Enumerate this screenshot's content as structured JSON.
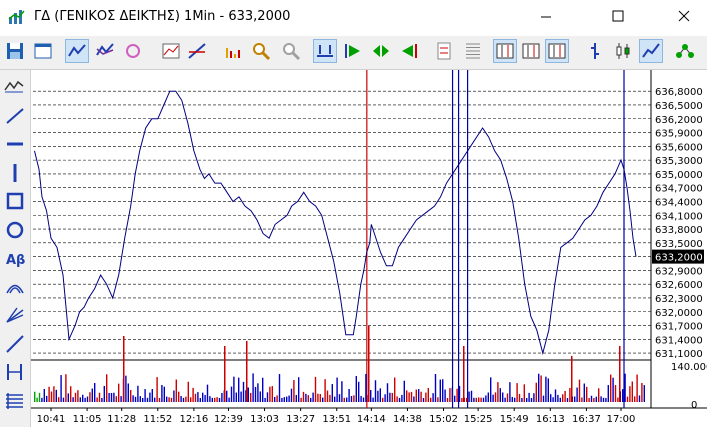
{
  "window": {
    "title": "ΓΔ (ΓΕΝΙΚΟΣ ΔΕΙΚΤΗΣ) 1Min - 633,2000",
    "controls": [
      "minimize-icon",
      "maximize-icon",
      "close-icon"
    ]
  },
  "toolbar": {
    "buttons": [
      {
        "name": "save-button",
        "icon": "floppy-disk-icon"
      },
      {
        "name": "properties-button",
        "icon": "window-icon"
      },
      {
        "name": "chart-style-button",
        "icon": "candlestick-icon",
        "pressed": true
      },
      {
        "name": "compare-button",
        "icon": "compare-icon"
      },
      {
        "name": "refresh-button",
        "icon": "refresh-icon"
      },
      {
        "name": "indicator-button",
        "icon": "indicator-icon"
      },
      {
        "name": "trendline-tool-button",
        "icon": "trendline-icon"
      },
      {
        "name": "volume-button",
        "icon": "volume-bars-icon"
      },
      {
        "name": "zoom-in-button",
        "icon": "zoom-in-icon"
      },
      {
        "name": "zoom-out-button",
        "icon": "zoom-out-icon"
      },
      {
        "name": "fit-button",
        "icon": "fit-icon",
        "pressed": true
      },
      {
        "name": "scroll-start-button",
        "icon": "go-start-icon"
      },
      {
        "name": "scroll-mid-button",
        "icon": "go-center-icon"
      },
      {
        "name": "scroll-end-button",
        "icon": "go-end-icon"
      },
      {
        "name": "decimals-button",
        "icon": "decimals-icon"
      },
      {
        "name": "grid-button",
        "icon": "grid-icon"
      },
      {
        "name": "interval-5-button",
        "icon": "interval-icon",
        "pressed": true
      },
      {
        "name": "interval-10-button",
        "icon": "interval-icon"
      },
      {
        "name": "interval-510-button",
        "icon": "interval-icon",
        "pressed": true
      },
      {
        "name": "bar-chart-button",
        "icon": "bar-icon"
      },
      {
        "name": "candle-chart-button",
        "icon": "candle-icon"
      },
      {
        "name": "line-chart-button",
        "icon": "line-icon",
        "pressed": true
      },
      {
        "name": "network-button",
        "icon": "network-icon"
      }
    ]
  },
  "drawing_tools": [
    {
      "name": "autoline-tool",
      "icon": "zigzag-icon"
    },
    {
      "name": "line-tool",
      "icon": "diagonal-line-icon"
    },
    {
      "name": "horizontal-line-tool",
      "icon": "horizontal-line-icon"
    },
    {
      "name": "vertical-line-tool",
      "icon": "vertical-line-icon"
    },
    {
      "name": "rectangle-tool",
      "icon": "rectangle-icon"
    },
    {
      "name": "ellipse-tool",
      "icon": "ellipse-icon"
    },
    {
      "name": "text-tool",
      "icon": "text-icon",
      "label": "Aβ"
    },
    {
      "name": "arc-tool",
      "icon": "arc-icon"
    },
    {
      "name": "fan-tool",
      "icon": "fan-icon"
    },
    {
      "name": "ray-tool",
      "icon": "ray-icon"
    },
    {
      "name": "channel-tool",
      "icon": "channel-icon"
    },
    {
      "name": "fibonacci-tool",
      "icon": "fibonacci-icon"
    }
  ],
  "colors": {
    "price_line": "#000080",
    "volume_blue": "#0000c0",
    "volume_red": "#cc0000",
    "volume_green": "#00a000",
    "grid": "#000000",
    "marker_red": "#cc0000",
    "marker_blue": "#0000aa",
    "current_price_bg": "#000000",
    "current_price_fg": "#ffffff"
  },
  "chart_data": {
    "type": "line",
    "title": "ΓΔ (ΓΕΝΙΚΟΣ ΔΕΙΚΤΗΣ) 1Min",
    "y_tick_labels": [
      "636,8000",
      "636,5000",
      "636,2000",
      "635,9000",
      "635,6000",
      "635,3000",
      "635,0000",
      "634,7000",
      "634,4000",
      "634,1000",
      "633,8000",
      "633,5000",
      "633,2000",
      "632,9000",
      "632,6000",
      "632,3000",
      "632,0000",
      "631,7000",
      "631,4000",
      "631,1000"
    ],
    "ylim": [
      630.95,
      637.0
    ],
    "current_price": 633.2,
    "current_price_label": "633,2000",
    "x_tick_labels": [
      "10:41",
      "11:05",
      "11:28",
      "11:52",
      "12:16",
      "12:39",
      "13:03",
      "13:27",
      "13:51",
      "14:14",
      "14:38",
      "15:02",
      "15:25",
      "15:49",
      "16:13",
      "16:37",
      "17:00"
    ],
    "series": [
      {
        "name": "",
        "x": [
          "10:30",
          "10:33",
          "10:35",
          "10:38",
          "10:41",
          "10:45",
          "10:49",
          "10:53",
          "10:57",
          "11:00",
          "11:03",
          "11:06",
          "11:10",
          "11:14",
          "11:18",
          "11:22",
          "11:26",
          "11:30",
          "11:34",
          "11:37",
          "11:40",
          "11:44",
          "11:48",
          "11:52",
          "11:56",
          "12:00",
          "12:04",
          "12:08",
          "12:12",
          "12:14",
          "12:16",
          "12:18",
          "12:20",
          "12:23",
          "12:26",
          "12:30",
          "12:34",
          "12:38",
          "12:42",
          "12:46",
          "12:50",
          "12:54",
          "12:58",
          "13:02",
          "13:06",
          "13:10",
          "13:14",
          "13:18",
          "13:21",
          "13:25",
          "13:29",
          "13:33",
          "13:37",
          "13:41",
          "13:45",
          "13:49",
          "13:53",
          "13:57",
          "14:00",
          "14:02",
          "14:04",
          "14:07",
          "14:09",
          "14:11",
          "14:13",
          "14:14",
          "14:16",
          "14:20",
          "14:24",
          "14:28",
          "14:32",
          "14:36",
          "14:40",
          "14:44",
          "14:48",
          "14:52",
          "14:56",
          "15:00",
          "15:04",
          "15:08",
          "15:12",
          "15:16",
          "15:20",
          "15:24",
          "15:28",
          "15:32",
          "15:36",
          "15:40",
          "15:44",
          "15:48",
          "15:52",
          "15:56",
          "16:00",
          "16:04",
          "16:08",
          "16:12",
          "16:16",
          "16:20",
          "16:24",
          "16:28",
          "16:32",
          "16:36",
          "16:40",
          "16:44",
          "16:48",
          "16:52",
          "16:56",
          "17:00",
          "17:02",
          "17:04",
          "17:06",
          "17:08",
          "17:10"
        ],
        "values": [
          635.5,
          635.1,
          634.5,
          634.2,
          633.6,
          633.4,
          632.8,
          631.4,
          631.7,
          632.0,
          632.1,
          632.3,
          632.5,
          632.8,
          632.6,
          632.3,
          632.8,
          633.6,
          634.3,
          635.0,
          635.5,
          636.0,
          636.2,
          636.2,
          636.5,
          636.8,
          636.8,
          636.6,
          636.1,
          635.8,
          635.5,
          635.3,
          635.1,
          634.9,
          635.0,
          634.8,
          634.8,
          634.6,
          634.4,
          634.5,
          634.3,
          634.2,
          634.0,
          633.7,
          633.6,
          633.9,
          634.0,
          634.1,
          634.3,
          634.4,
          634.6,
          634.4,
          634.3,
          634.1,
          633.6,
          633.1,
          632.4,
          631.5,
          631.5,
          631.5,
          631.9,
          632.6,
          632.9,
          633.3,
          633.5,
          633.9,
          633.7,
          633.3,
          633.0,
          633.0,
          633.4,
          633.6,
          633.8,
          634.0,
          634.1,
          634.2,
          634.3,
          634.5,
          634.8,
          635.0,
          635.2,
          635.4,
          635.6,
          635.8,
          636.0,
          635.8,
          635.5,
          635.3,
          634.9,
          634.4,
          633.6,
          632.6,
          631.9,
          631.6,
          631.1,
          631.6,
          632.6,
          633.4,
          633.5,
          633.6,
          633.8,
          634.0,
          634.1,
          634.3,
          634.6,
          634.8,
          635.0,
          635.3,
          635.1,
          634.7,
          634.2,
          633.6,
          633.2
        ]
      }
    ],
    "volume": {
      "y_tick_labels": [
        "140.000",
        "0"
      ],
      "ylim": [
        0,
        140000
      ]
    },
    "vertical_markers": [
      {
        "x": "14:11",
        "color": "red"
      },
      {
        "x": "15:08",
        "color": "blue"
      },
      {
        "x": "15:12",
        "color": "blue"
      },
      {
        "x": "15:18",
        "color": "blue"
      },
      {
        "x": "17:02",
        "color": "blue"
      }
    ],
    "grid": true,
    "legend": "none"
  }
}
